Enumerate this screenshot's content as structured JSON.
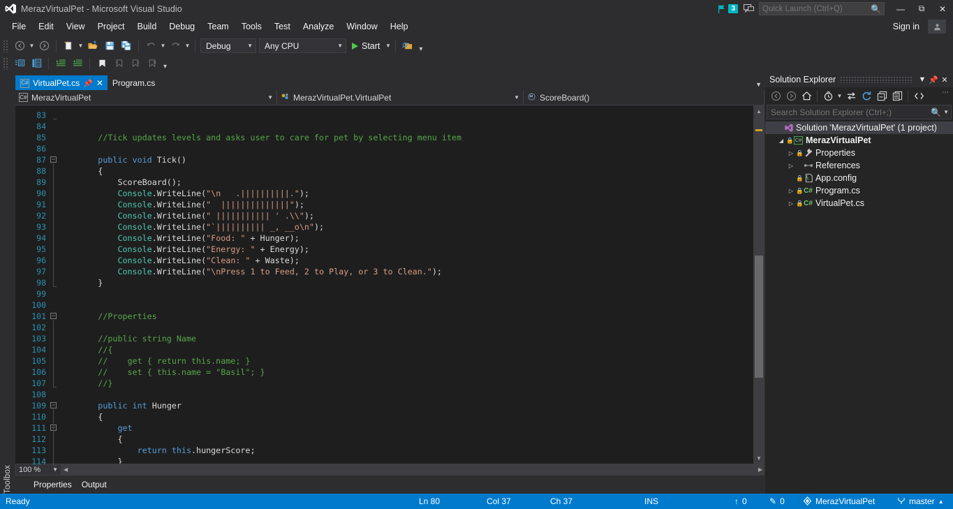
{
  "window": {
    "title": "MerazVirtualPet - Microsoft Visual Studio",
    "logo_icon": "visual-studio-logo",
    "notification_count": "3",
    "notification_icon": "flag-icon",
    "feedback_icon": "feedback-icon",
    "minimize_icon": "minimize-icon",
    "maximize_icon": "maximize-icon",
    "close_icon": "close-icon"
  },
  "quick_launch": {
    "placeholder": "Quick Launch (Ctrl+Q)",
    "value": "",
    "icon": "search-icon"
  },
  "menu": {
    "items": [
      "File",
      "Edit",
      "View",
      "Project",
      "Build",
      "Debug",
      "Team",
      "Tools",
      "Test",
      "Analyze",
      "Window",
      "Help"
    ],
    "sign_in": "Sign in",
    "account_icon": "account-icon"
  },
  "toolbar": {
    "row1": [
      {
        "name": "navigate-backward-icon",
        "glyph": "back"
      },
      {
        "name": "navigate-backward-dropdown-icon",
        "glyph": "caret"
      },
      {
        "name": "navigate-forward-icon",
        "glyph": "forward"
      },
      {
        "name": "new-project-icon",
        "glyph": "newproj"
      },
      {
        "name": "new-project-dropdown-icon",
        "glyph": "caret"
      },
      {
        "name": "open-file-icon",
        "glyph": "openfolder"
      },
      {
        "name": "save-icon",
        "glyph": "save"
      },
      {
        "name": "save-all-icon",
        "glyph": "saveall"
      },
      {
        "name": "undo-icon",
        "glyph": "undo"
      },
      {
        "name": "undo-dropdown-icon",
        "glyph": "caret"
      },
      {
        "name": "redo-icon",
        "glyph": "redo"
      },
      {
        "name": "redo-dropdown-icon",
        "glyph": "caret"
      }
    ],
    "configuration": "Debug",
    "platform": "Any CPU",
    "start_label": "Start",
    "start_icon": "play-icon",
    "attach_icon": "attach-to-process-icon",
    "overflow_icon": "toolbar-overflow-icon",
    "row2": [
      {
        "name": "toggle-solution-explorer-icon"
      },
      {
        "name": "properties-window-icon"
      },
      {
        "name": "increase-indent-icon"
      },
      {
        "name": "decrease-indent-icon"
      },
      {
        "name": "toggle-bookmark-icon"
      },
      {
        "name": "previous-bookmark-icon"
      },
      {
        "name": "next-bookmark-icon"
      },
      {
        "name": "clear-bookmarks-icon"
      }
    ]
  },
  "left_rail": {
    "toolbox_label": "Toolbox"
  },
  "tabs": {
    "items": [
      {
        "label": "VirtualPet.cs",
        "active": true,
        "icon": "csharp-file-icon",
        "pin_icon": "pin-icon",
        "close_icon": "close-icon"
      },
      {
        "label": "Program.cs",
        "active": false,
        "icon": "csharp-file-icon"
      }
    ],
    "tab_list_icon": "chevron-down-icon"
  },
  "navbar": {
    "project": "MerazVirtualPet",
    "project_icon": "csharp-project-icon",
    "type": "MerazVirtualPet.VirtualPet",
    "type_icon": "class-icon",
    "member": "ScoreBoard()",
    "member_icon": "method-icon",
    "dropdown_icon": "chevron-down-icon"
  },
  "editor": {
    "first_line": 83,
    "lines": [
      {
        "n": 83,
        "fold": null,
        "tokens": []
      },
      {
        "n": 84,
        "fold": null,
        "tokens": []
      },
      {
        "n": 85,
        "fold": null,
        "tokens": [
          [
            "com",
            "        //Tick updates levels and asks user to care for pet by selecting menu item"
          ]
        ]
      },
      {
        "n": 86,
        "fold": null,
        "tokens": []
      },
      {
        "n": 87,
        "fold": "minus",
        "tokens": [
          [
            "kw",
            "        public void "
          ],
          [
            "txt",
            "Tick()"
          ]
        ]
      },
      {
        "n": 88,
        "fold": null,
        "tokens": [
          [
            "txt",
            "        {"
          ]
        ]
      },
      {
        "n": 89,
        "fold": null,
        "tokens": [
          [
            "txt",
            "            ScoreBoard();"
          ]
        ]
      },
      {
        "n": 90,
        "fold": null,
        "tokens": [
          [
            "type",
            "            Console"
          ],
          [
            "txt",
            "."
          ],
          [
            "me",
            "WriteLine"
          ],
          [
            "txt",
            "("
          ],
          [
            "str",
            "\"\\n   .||||||||||.\""
          ],
          [
            "txt",
            ");"
          ]
        ]
      },
      {
        "n": 91,
        "fold": null,
        "tokens": [
          [
            "type",
            "            Console"
          ],
          [
            "txt",
            "."
          ],
          [
            "me",
            "WriteLine"
          ],
          [
            "txt",
            "("
          ],
          [
            "str",
            "\"  ||||||||||||||\""
          ],
          [
            "txt",
            ");"
          ]
        ]
      },
      {
        "n": 92,
        "fold": null,
        "tokens": [
          [
            "type",
            "            Console"
          ],
          [
            "txt",
            "."
          ],
          [
            "me",
            "WriteLine"
          ],
          [
            "txt",
            "("
          ],
          [
            "str",
            "\" ||||||||||| ' .\\\\\""
          ],
          [
            "txt",
            ");"
          ]
        ]
      },
      {
        "n": 93,
        "fold": null,
        "tokens": [
          [
            "type",
            "            Console"
          ],
          [
            "txt",
            "."
          ],
          [
            "me",
            "WriteLine"
          ],
          [
            "txt",
            "("
          ],
          [
            "str",
            "\"`|||||||||| _, __o\\n\""
          ],
          [
            "txt",
            ");"
          ]
        ]
      },
      {
        "n": 94,
        "fold": null,
        "tokens": [
          [
            "type",
            "            Console"
          ],
          [
            "txt",
            "."
          ],
          [
            "me",
            "WriteLine"
          ],
          [
            "txt",
            "("
          ],
          [
            "str",
            "\"Food: \""
          ],
          [
            "txt",
            " + Hunger);"
          ]
        ]
      },
      {
        "n": 95,
        "fold": null,
        "tokens": [
          [
            "type",
            "            Console"
          ],
          [
            "txt",
            "."
          ],
          [
            "me",
            "WriteLine"
          ],
          [
            "txt",
            "("
          ],
          [
            "str",
            "\"Energy: \""
          ],
          [
            "txt",
            " + Energy);"
          ]
        ]
      },
      {
        "n": 96,
        "fold": null,
        "tokens": [
          [
            "type",
            "            Console"
          ],
          [
            "txt",
            "."
          ],
          [
            "me",
            "WriteLine"
          ],
          [
            "txt",
            "("
          ],
          [
            "str",
            "\"Clean: \""
          ],
          [
            "txt",
            " + Waste);"
          ]
        ]
      },
      {
        "n": 97,
        "fold": null,
        "tokens": [
          [
            "type",
            "            Console"
          ],
          [
            "txt",
            "."
          ],
          [
            "me",
            "WriteLine"
          ],
          [
            "txt",
            "("
          ],
          [
            "str",
            "\"\\nPress 1 to Feed, 2 to Play, or 3 to Clean.\""
          ],
          [
            "txt",
            ");"
          ]
        ]
      },
      {
        "n": 98,
        "fold": null,
        "tokens": [
          [
            "txt",
            "        }"
          ]
        ]
      },
      {
        "n": 99,
        "fold": null,
        "tokens": []
      },
      {
        "n": 100,
        "fold": null,
        "tokens": []
      },
      {
        "n": 101,
        "fold": "minus",
        "tokens": [
          [
            "com",
            "        //Properties"
          ]
        ]
      },
      {
        "n": 102,
        "fold": null,
        "tokens": []
      },
      {
        "n": 103,
        "fold": null,
        "tokens": [
          [
            "com",
            "        //public string Name"
          ]
        ]
      },
      {
        "n": 104,
        "fold": null,
        "tokens": [
          [
            "com",
            "        //{"
          ]
        ]
      },
      {
        "n": 105,
        "fold": null,
        "tokens": [
          [
            "com",
            "        //    get { return this.name; }"
          ]
        ]
      },
      {
        "n": 106,
        "fold": null,
        "tokens": [
          [
            "com",
            "        //    set { this.name = \"Basil\"; }"
          ]
        ]
      },
      {
        "n": 107,
        "fold": null,
        "tokens": [
          [
            "com",
            "        //}"
          ]
        ]
      },
      {
        "n": 108,
        "fold": null,
        "tokens": []
      },
      {
        "n": 109,
        "fold": "minus",
        "tokens": [
          [
            "kw",
            "        public int "
          ],
          [
            "txt",
            "Hunger"
          ]
        ]
      },
      {
        "n": 110,
        "fold": null,
        "tokens": [
          [
            "txt",
            "        {"
          ]
        ]
      },
      {
        "n": 111,
        "fold": "minus",
        "tokens": [
          [
            "kw",
            "            get"
          ]
        ]
      },
      {
        "n": 112,
        "fold": null,
        "tokens": [
          [
            "txt",
            "            {"
          ]
        ]
      },
      {
        "n": 113,
        "fold": null,
        "tokens": [
          [
            "kw",
            "                return "
          ],
          [
            "kw",
            "this"
          ],
          [
            "txt",
            ".hungerScore;"
          ]
        ]
      },
      {
        "n": 114,
        "fold": null,
        "tokens": [
          [
            "txt",
            "            }"
          ]
        ]
      }
    ],
    "zoom_level": "100 %",
    "scroll_up_icon": "scroll-up-icon",
    "scroll_down_icon": "scroll-down-icon"
  },
  "bottom_tabs": [
    "Properties",
    "Output"
  ],
  "solution_explorer": {
    "title": "Solution Explorer",
    "dropdown_icon": "chevron-down-icon",
    "pin_icon": "pin-icon",
    "close_icon": "close-icon",
    "toolbar": [
      {
        "name": "back-icon"
      },
      {
        "name": "forward-icon"
      },
      {
        "name": "home-icon"
      },
      {
        "name": "pending-changes-filter-icon"
      },
      {
        "name": "pending-changes-dropdown-icon"
      },
      {
        "name": "sync-with-active-document-icon"
      },
      {
        "name": "refresh-icon"
      },
      {
        "name": "collapse-all-icon"
      },
      {
        "name": "properties-icon"
      },
      {
        "name": "show-all-files-icon"
      }
    ],
    "overflow_icon": "solution-explorer-overflow-icon",
    "search": {
      "placeholder": "Search Solution Explorer (Ctrl+;)",
      "value": "",
      "icon": "search-icon",
      "dropdown_icon": "chevron-down-icon"
    },
    "tree": [
      {
        "indent": 0,
        "arrow": "none",
        "lock": false,
        "icon": "solution-icon",
        "label": "Solution 'MerazVirtualPet' (1 project)",
        "bold": false,
        "selected": true
      },
      {
        "indent": 1,
        "arrow": "open",
        "lock": true,
        "icon": "csharp-project-icon",
        "label": "MerazVirtualPet",
        "bold": true,
        "selected": false
      },
      {
        "indent": 2,
        "arrow": "closed",
        "lock": true,
        "icon": "properties-wrench-icon",
        "label": "Properties",
        "bold": false,
        "selected": false
      },
      {
        "indent": 2,
        "arrow": "closed",
        "lock": false,
        "icon": "references-icon",
        "label": "References",
        "bold": false,
        "selected": false
      },
      {
        "indent": 2,
        "arrow": "none",
        "lock": true,
        "icon": "config-file-icon",
        "label": "App.config",
        "bold": false,
        "selected": false
      },
      {
        "indent": 2,
        "arrow": "closed",
        "lock": true,
        "icon": "csharp-file-icon",
        "label": "Program.cs",
        "bold": false,
        "selected": false
      },
      {
        "indent": 2,
        "arrow": "closed",
        "lock": true,
        "icon": "csharp-file-icon",
        "label": "VirtualPet.cs",
        "bold": false,
        "selected": false
      }
    ]
  },
  "status_bar": {
    "ready": "Ready",
    "line": "Ln 80",
    "column": "Col 37",
    "character": "Ch 37",
    "insert_mode": "INS",
    "publish_count": "0",
    "publish_icon": "up-arrow-icon",
    "edit_count": "0",
    "edit_icon": "pencil-icon",
    "repository": "MerazVirtualPet",
    "repository_icon": "source-control-icon",
    "branch": "master",
    "branch_icon": "branch-icon",
    "branch_caret": "caret-up-icon"
  }
}
